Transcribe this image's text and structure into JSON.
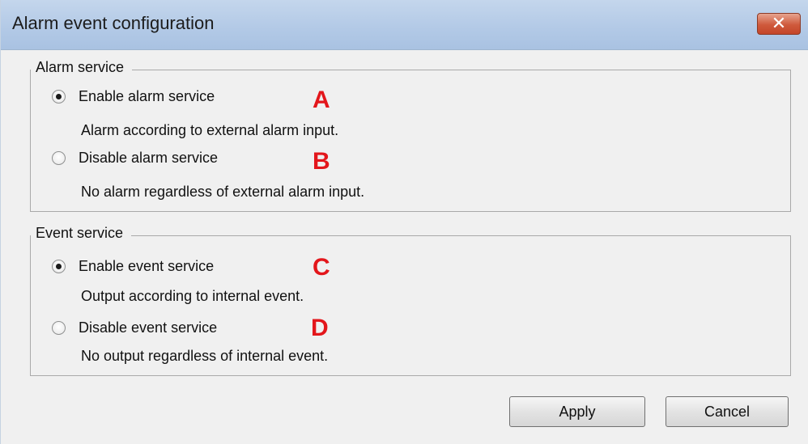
{
  "window": {
    "title": "Alarm event configuration",
    "close_label": "✕"
  },
  "alarm_group": {
    "title": "Alarm service",
    "options": [
      {
        "label": "Enable alarm service",
        "description": "Alarm according to external alarm input.",
        "letter": "A",
        "checked": true
      },
      {
        "label": "Disable alarm service",
        "description": "No alarm regardless of external alarm input.",
        "letter": "B",
        "checked": false
      }
    ]
  },
  "event_group": {
    "title": "Event service",
    "options": [
      {
        "label": "Enable event service",
        "description": "Output according to internal event.",
        "letter": "C",
        "checked": true
      },
      {
        "label": "Disable event service",
        "description": "No output regardless of internal event.",
        "letter": "D",
        "checked": false
      }
    ]
  },
  "buttons": {
    "apply": "Apply",
    "cancel": "Cancel"
  },
  "colors": {
    "annotation_red": "#e3161b",
    "titlebar_blue": "#b2c9e6",
    "close_red": "#cf5a3c"
  }
}
